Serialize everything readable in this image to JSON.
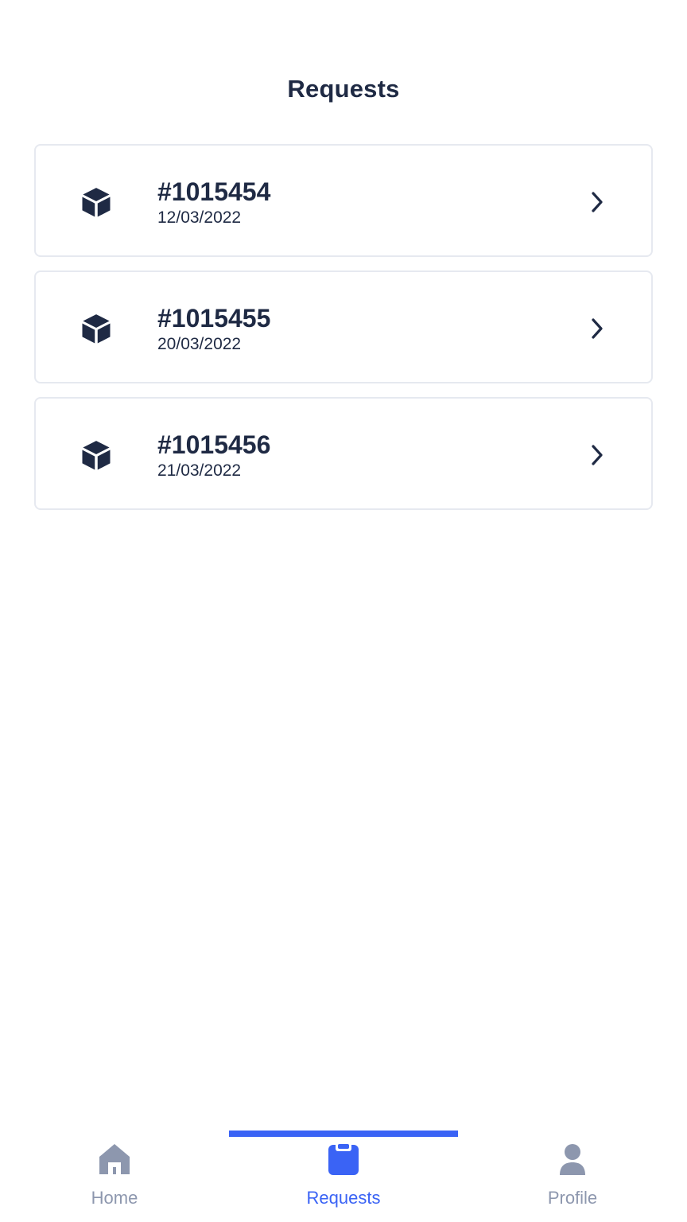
{
  "header": {
    "title": "Requests"
  },
  "requests": [
    {
      "id": "#1015454",
      "date": "12/03/2022"
    },
    {
      "id": "#1015455",
      "date": "20/03/2022"
    },
    {
      "id": "#1015456",
      "date": "21/03/2022"
    }
  ],
  "icons": {
    "card": "box-icon",
    "card_action": "chevron-right-icon"
  },
  "bottom_nav": {
    "items": [
      {
        "label": "Home",
        "icon": "home-icon",
        "active": false
      },
      {
        "label": "Requests",
        "icon": "clipboard-icon",
        "active": true
      },
      {
        "label": "Profile",
        "icon": "user-icon",
        "active": false
      }
    ]
  },
  "colors": {
    "text_primary": "#1f2a44",
    "accent": "#3a63f5",
    "inactive": "#8d97ae",
    "card_border": "#e6e9f0"
  }
}
